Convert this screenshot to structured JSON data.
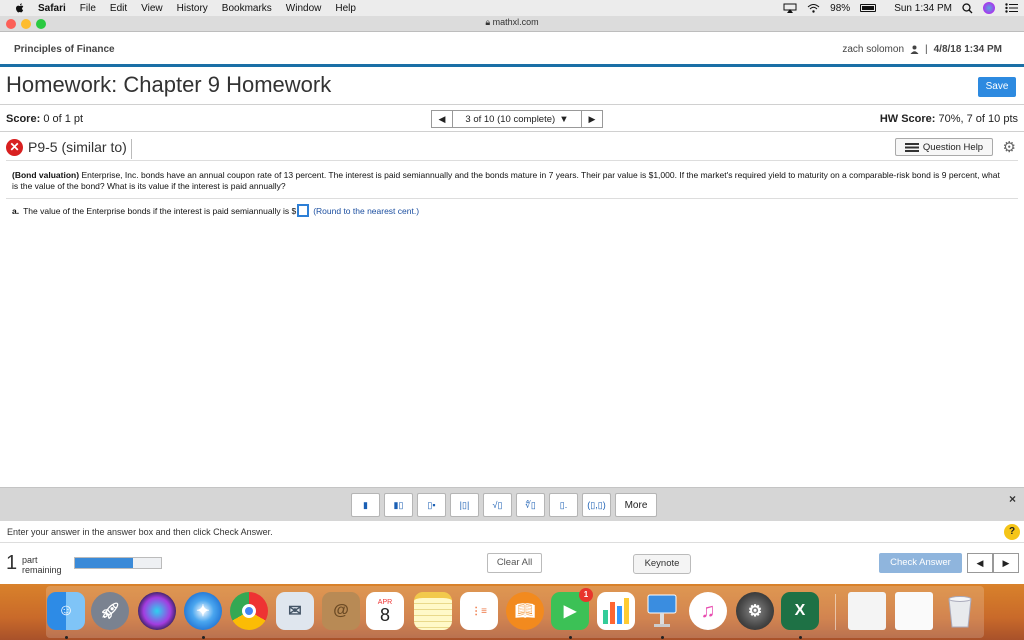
{
  "menubar": {
    "app": "Safari",
    "items": [
      "File",
      "Edit",
      "View",
      "History",
      "Bookmarks",
      "Window",
      "Help"
    ],
    "battery": "98%",
    "clock": "Sun 1:34 PM"
  },
  "browser": {
    "url": "mathxl.com"
  },
  "header": {
    "course": "Principles of Finance",
    "user": "zach solomon",
    "separator": "|",
    "date": "4/8/18 1:34 PM"
  },
  "homework": {
    "title": "Homework: Chapter 9 Homework",
    "save_label": "Save",
    "score_label": "Score:",
    "score_value": "0 of 1 pt",
    "nav_counter": "3 of 10 (10 complete)",
    "hw_score_label": "HW Score:",
    "hw_score_value": "70%, 7 of 10 pts"
  },
  "question": {
    "id": "P9-5 (similar to)",
    "help_label": "Question Help",
    "title_bold": "(Bond valuation)",
    "text": "Enterprise, Inc. bonds have an annual coupon rate of 13 percent.  The interest is paid semiannually and the bonds mature in 7 years.  Their par value is $1,000.  If the market's required yield to maturity on a comparable-risk bond is 9 percent, what is the value of the bond?  What is its value if the interest is paid annually?",
    "part_a_label": "a.",
    "part_a_text": "The value of the Enterprise bonds if the interest is paid semiannually is $",
    "part_a_answer": "",
    "part_a_hint": "(Round to the nearest cent.)"
  },
  "math_toolbar": {
    "buttons": [
      "▮",
      "▮▯",
      "▯▪",
      "|▯|",
      "√▯",
      "∜▯",
      "▯.",
      "(▯,▯)"
    ],
    "more_label": "More",
    "close": "×"
  },
  "instructions": "Enter your answer in the answer box and then click Check Answer.",
  "footer": {
    "parts_count": "1",
    "parts_label_1": "part",
    "parts_label_2": "remaining",
    "progress": 0.67,
    "clear_all": "Clear All",
    "tooltip": "Keynote",
    "check_answer": "Check Answer"
  },
  "dock": {
    "icons": [
      "finder-icon",
      "launchpad-icon",
      "siri-icon",
      "safari-icon",
      "chrome-icon",
      "mail-icon",
      "contacts-icon",
      "calendar-icon",
      "notes-icon",
      "reminders-icon",
      "ibooks-icon",
      "facetime-icon",
      "numbers-icon",
      "keynote-icon",
      "itunes-icon",
      "system-preferences-icon",
      "excel-icon",
      "downloads-folder-icon",
      "trash-icon"
    ],
    "calendar_month": "APR",
    "calendar_day": "8",
    "facetime_badge": "1"
  },
  "colors": {
    "accent": "#1a6fa6",
    "save_button": "#2d8ae0",
    "error": "#d82020",
    "check_answer": "#8fb5dd"
  }
}
